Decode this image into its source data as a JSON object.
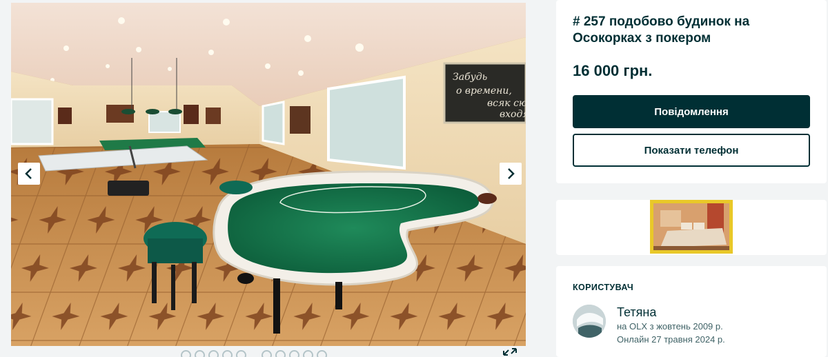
{
  "listing": {
    "title": "# 257 подобово будинок на Осокорках з покером",
    "price": "16 000 грн."
  },
  "actions": {
    "message_label": "Повідомлення",
    "show_phone_label": "Показати телефон"
  },
  "gallery": {
    "prev_icon": "chevron-left-icon",
    "next_icon": "chevron-right-icon",
    "fullscreen_icon": "expand-icon",
    "painting_text": [
      "Забудь",
      "о времени,",
      "всяк сю",
      "входя"
    ]
  },
  "user": {
    "heading": "КОРИСТУВАЧ",
    "name": "Тетяна",
    "member_since": "на OLX з жовтень 2009 р.",
    "last_online": "Онлайн 27 травня 2024 р."
  },
  "colors": {
    "brand_dark": "#002f34",
    "page_bg": "#f2f4f5"
  }
}
